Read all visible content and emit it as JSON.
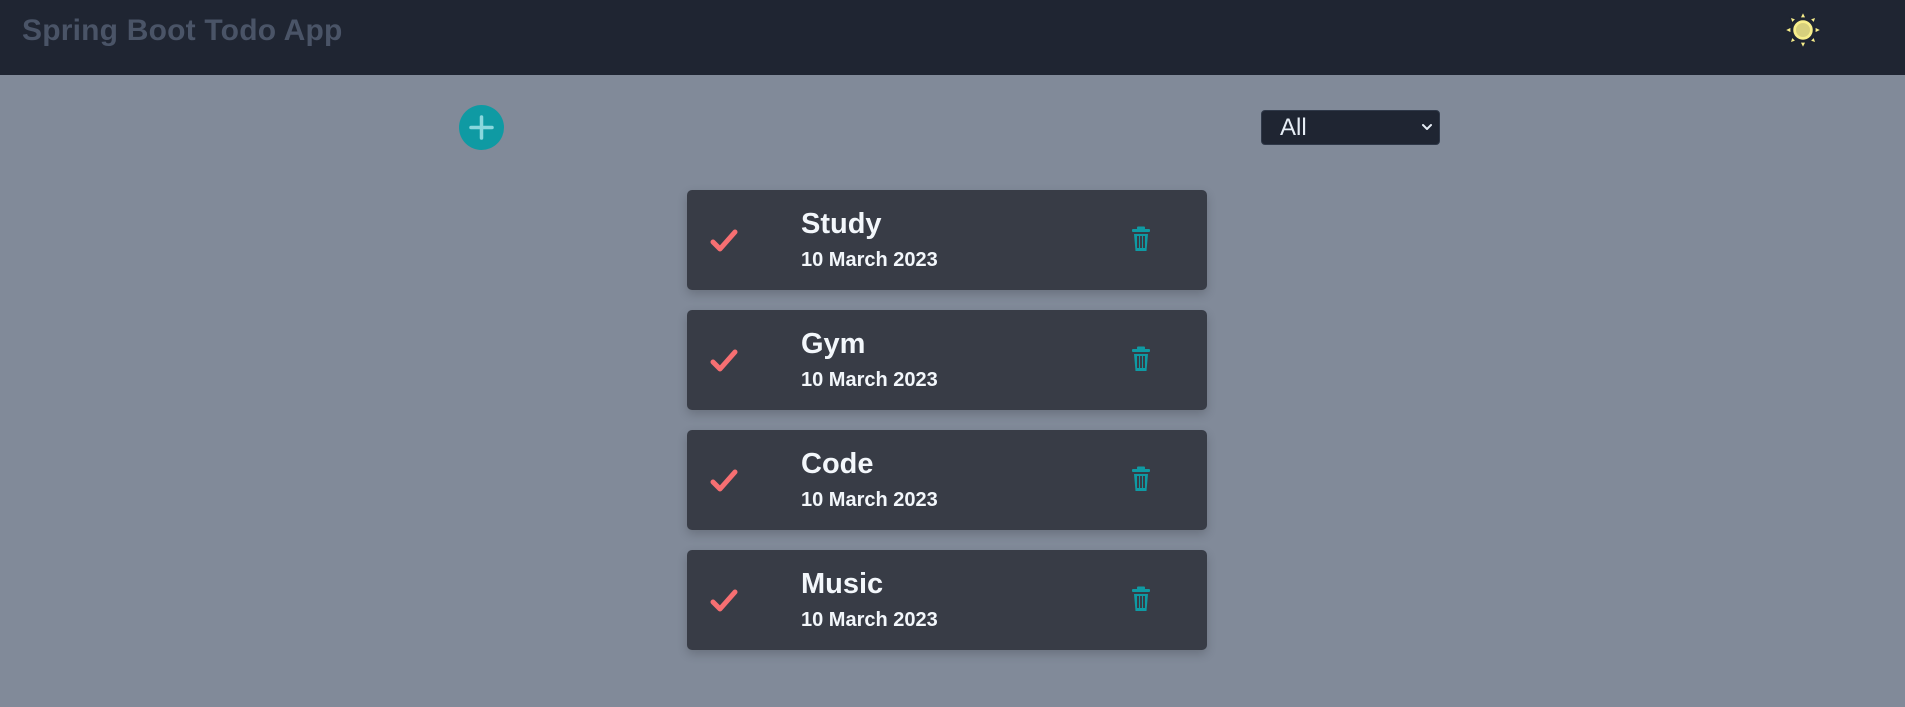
{
  "header": {
    "title": "Spring Boot Todo App",
    "theme_icon": "sun-icon"
  },
  "toolbar": {
    "add_icon": "plus-icon",
    "filter": {
      "selected": "All",
      "options": [
        "All"
      ]
    }
  },
  "todos": [
    {
      "title": "Study",
      "date": "10 March 2023",
      "status_icon": "check-icon",
      "action_icon": "trash-icon"
    },
    {
      "title": "Gym",
      "date": "10 March 2023",
      "status_icon": "check-icon",
      "action_icon": "trash-icon"
    },
    {
      "title": "Code",
      "date": "10 March 2023",
      "status_icon": "check-icon",
      "action_icon": "trash-icon"
    },
    {
      "title": "Music",
      "date": "10 March 2023",
      "status_icon": "check-icon",
      "action_icon": "trash-icon"
    }
  ],
  "colors": {
    "header_bg": "#1f2532",
    "page_bg": "#818a99",
    "card_bg": "#383c46",
    "accent": "#0f9aa3",
    "check": "#f76f72",
    "sun": "#f7ee8b",
    "title_muted": "#4a5467"
  }
}
